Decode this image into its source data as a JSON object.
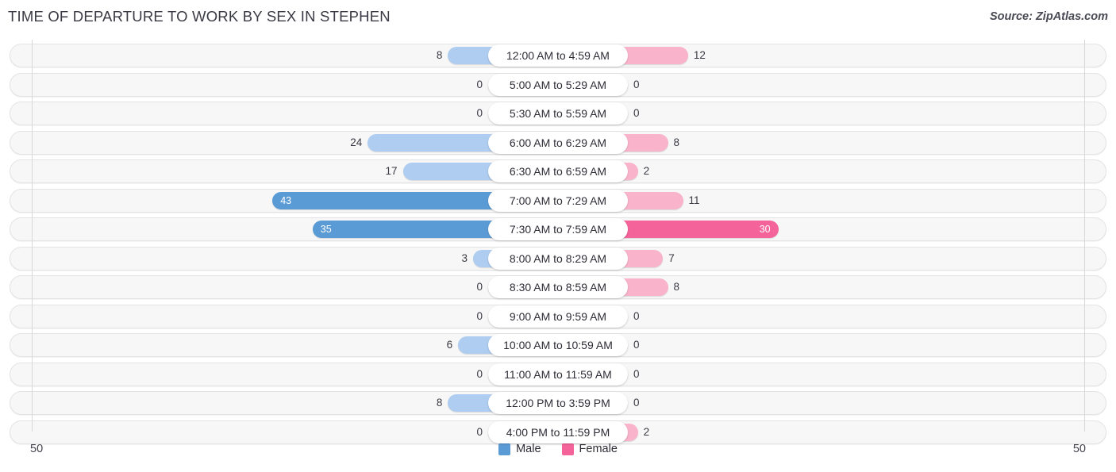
{
  "header": {
    "title": "TIME OF DEPARTURE TO WORK BY SEX IN STEPHEN",
    "source": "Source: ZipAtlas.com"
  },
  "axis": {
    "left_tick": "50",
    "right_tick": "50",
    "max": 50
  },
  "legend": {
    "items": [
      {
        "label": "Male",
        "color": "#5b9bd5"
      },
      {
        "label": "Female",
        "color": "#f4649b"
      }
    ]
  },
  "colors": {
    "male_strong": "#5b9bd5",
    "male_light": "#aecdf0",
    "female_strong": "#f4649b",
    "female_light": "#f9b4cb",
    "track": "#f7f7f7",
    "track_border": "#e3e3e6",
    "gridline": "#d8d8dc"
  },
  "chart_data": {
    "type": "bar",
    "orientation": "horizontal-diverging",
    "title": "TIME OF DEPARTURE TO WORK BY SEX IN STEPHEN",
    "xlabel": "",
    "ylabel": "",
    "xlim": [
      50,
      50
    ],
    "grid": true,
    "legend_position": "bottom-center",
    "categories": [
      "12:00 AM to 4:59 AM",
      "5:00 AM to 5:29 AM",
      "5:30 AM to 5:59 AM",
      "6:00 AM to 6:29 AM",
      "6:30 AM to 6:59 AM",
      "7:00 AM to 7:29 AM",
      "7:30 AM to 7:59 AM",
      "8:00 AM to 8:29 AM",
      "8:30 AM to 8:59 AM",
      "9:00 AM to 9:59 AM",
      "10:00 AM to 10:59 AM",
      "11:00 AM to 11:59 AM",
      "12:00 PM to 3:59 PM",
      "4:00 PM to 11:59 PM"
    ],
    "series": [
      {
        "name": "Male",
        "side": "left",
        "values": [
          8,
          0,
          0,
          24,
          17,
          43,
          35,
          3,
          0,
          0,
          6,
          0,
          8,
          0
        ]
      },
      {
        "name": "Female",
        "side": "right",
        "values": [
          12,
          0,
          0,
          8,
          2,
          11,
          30,
          7,
          8,
          0,
          0,
          0,
          0,
          2
        ]
      }
    ]
  }
}
